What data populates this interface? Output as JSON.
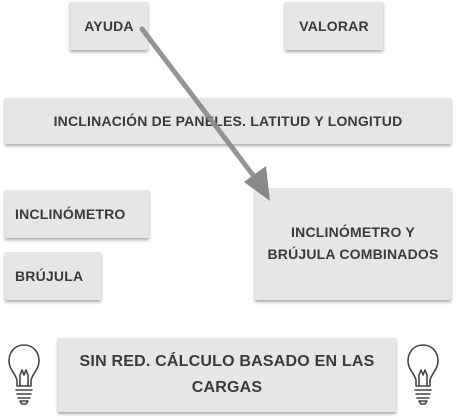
{
  "buttons": {
    "ayuda": "AYUDA",
    "valorar": "VALORAR",
    "inclinacion": "INCLINACIÓN DE PANELES. LATITUD Y LONGITUD",
    "inclinometro": "INCLINÓMETRO",
    "brujula": "BRÚJULA",
    "combinados": "INCLINÓMETRO Y BRÚJULA COMBINADOS",
    "sin_red": "SIN RED. CÁLCULO BASADO EN LAS CARGAS"
  },
  "icons": {
    "left_bulb": "lightbulb-icon",
    "right_bulb": "lightbulb-icon",
    "arrow": "arrow-annotation"
  },
  "colors": {
    "button_bg": "#e6e6e6",
    "button_text": "#3a3a3a",
    "arrow": "#8a8a8a"
  }
}
